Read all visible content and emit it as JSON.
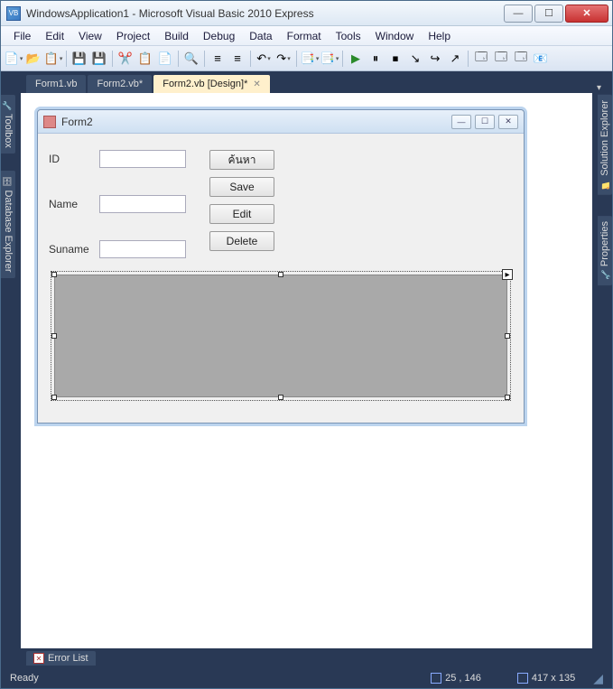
{
  "titlebar": {
    "icon_label": "VB",
    "text": "WindowsApplication1 - Microsoft Visual Basic 2010 Express"
  },
  "win_controls": {
    "min": "—",
    "max": "☐",
    "close": "✕"
  },
  "menu": [
    "File",
    "Edit",
    "View",
    "Project",
    "Build",
    "Debug",
    "Data",
    "Format",
    "Tools",
    "Window",
    "Help"
  ],
  "tabs": {
    "items": [
      {
        "label": "Form1.vb",
        "active": false,
        "closable": false
      },
      {
        "label": "Form2.vb*",
        "active": false,
        "closable": false
      },
      {
        "label": "Form2.vb [Design]*",
        "active": true,
        "closable": true
      }
    ],
    "right_glyph": "▾"
  },
  "side_panels": {
    "left": [
      "Toolbox",
      "Database Explorer"
    ],
    "right": [
      "Solution Explorer",
      "Properties"
    ]
  },
  "form_designer": {
    "title": "Form2",
    "controls": {
      "min": "—",
      "max": "☐",
      "close": "✕"
    },
    "fields": [
      {
        "label": "ID"
      },
      {
        "label": "Name"
      },
      {
        "label": "Suname"
      }
    ],
    "buttons": [
      "ค้นหา",
      "Save",
      "Edit",
      "Delete"
    ]
  },
  "bottom_tab": {
    "label": "Error List"
  },
  "status": {
    "text": "Ready",
    "coords": "25 , 146",
    "size": "417 x 135"
  }
}
